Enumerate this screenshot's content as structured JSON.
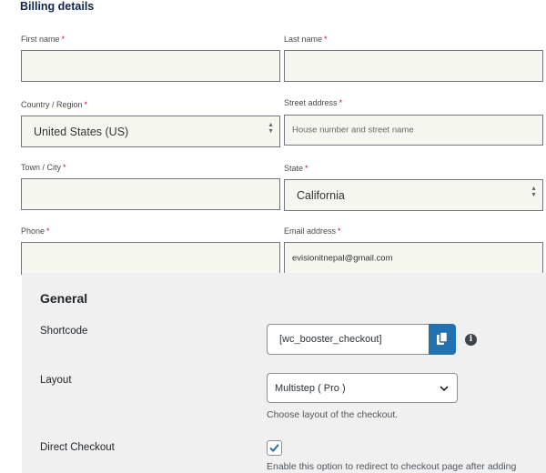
{
  "billing": {
    "title": "Billing details",
    "required_mark": "*",
    "first_name": {
      "label": "First name",
      "value": ""
    },
    "last_name": {
      "label": "Last name",
      "value": ""
    },
    "country": {
      "label": "Country / Region",
      "value": "United States (US)"
    },
    "street": {
      "label": "Street address",
      "placeholder": "House number and street name"
    },
    "city": {
      "label": "Town / City",
      "value": ""
    },
    "state": {
      "label": "State",
      "value": "California"
    },
    "phone": {
      "label": "Phone",
      "value": ""
    },
    "email": {
      "label": "Email address",
      "value": "evisionitnepal@gmail.com"
    }
  },
  "settings": {
    "title": "General",
    "shortcode": {
      "label": "Shortcode",
      "value": "[wc_booster_checkout]",
      "copy_icon": "copy-icon",
      "info_icon": "info-icon"
    },
    "layout": {
      "label": "Layout",
      "selected": "Multistep ( Pro )",
      "description": "Choose layout of the checkout."
    },
    "direct_checkout": {
      "label": "Direct Checkout",
      "checked": true,
      "description": "Enable this option to redirect to checkout page after adding"
    }
  },
  "colors": {
    "accent": "#2271b1",
    "required": "#c8102e",
    "panel_bg": "#f0f0f1",
    "field_bg": "#f6f6f1"
  }
}
